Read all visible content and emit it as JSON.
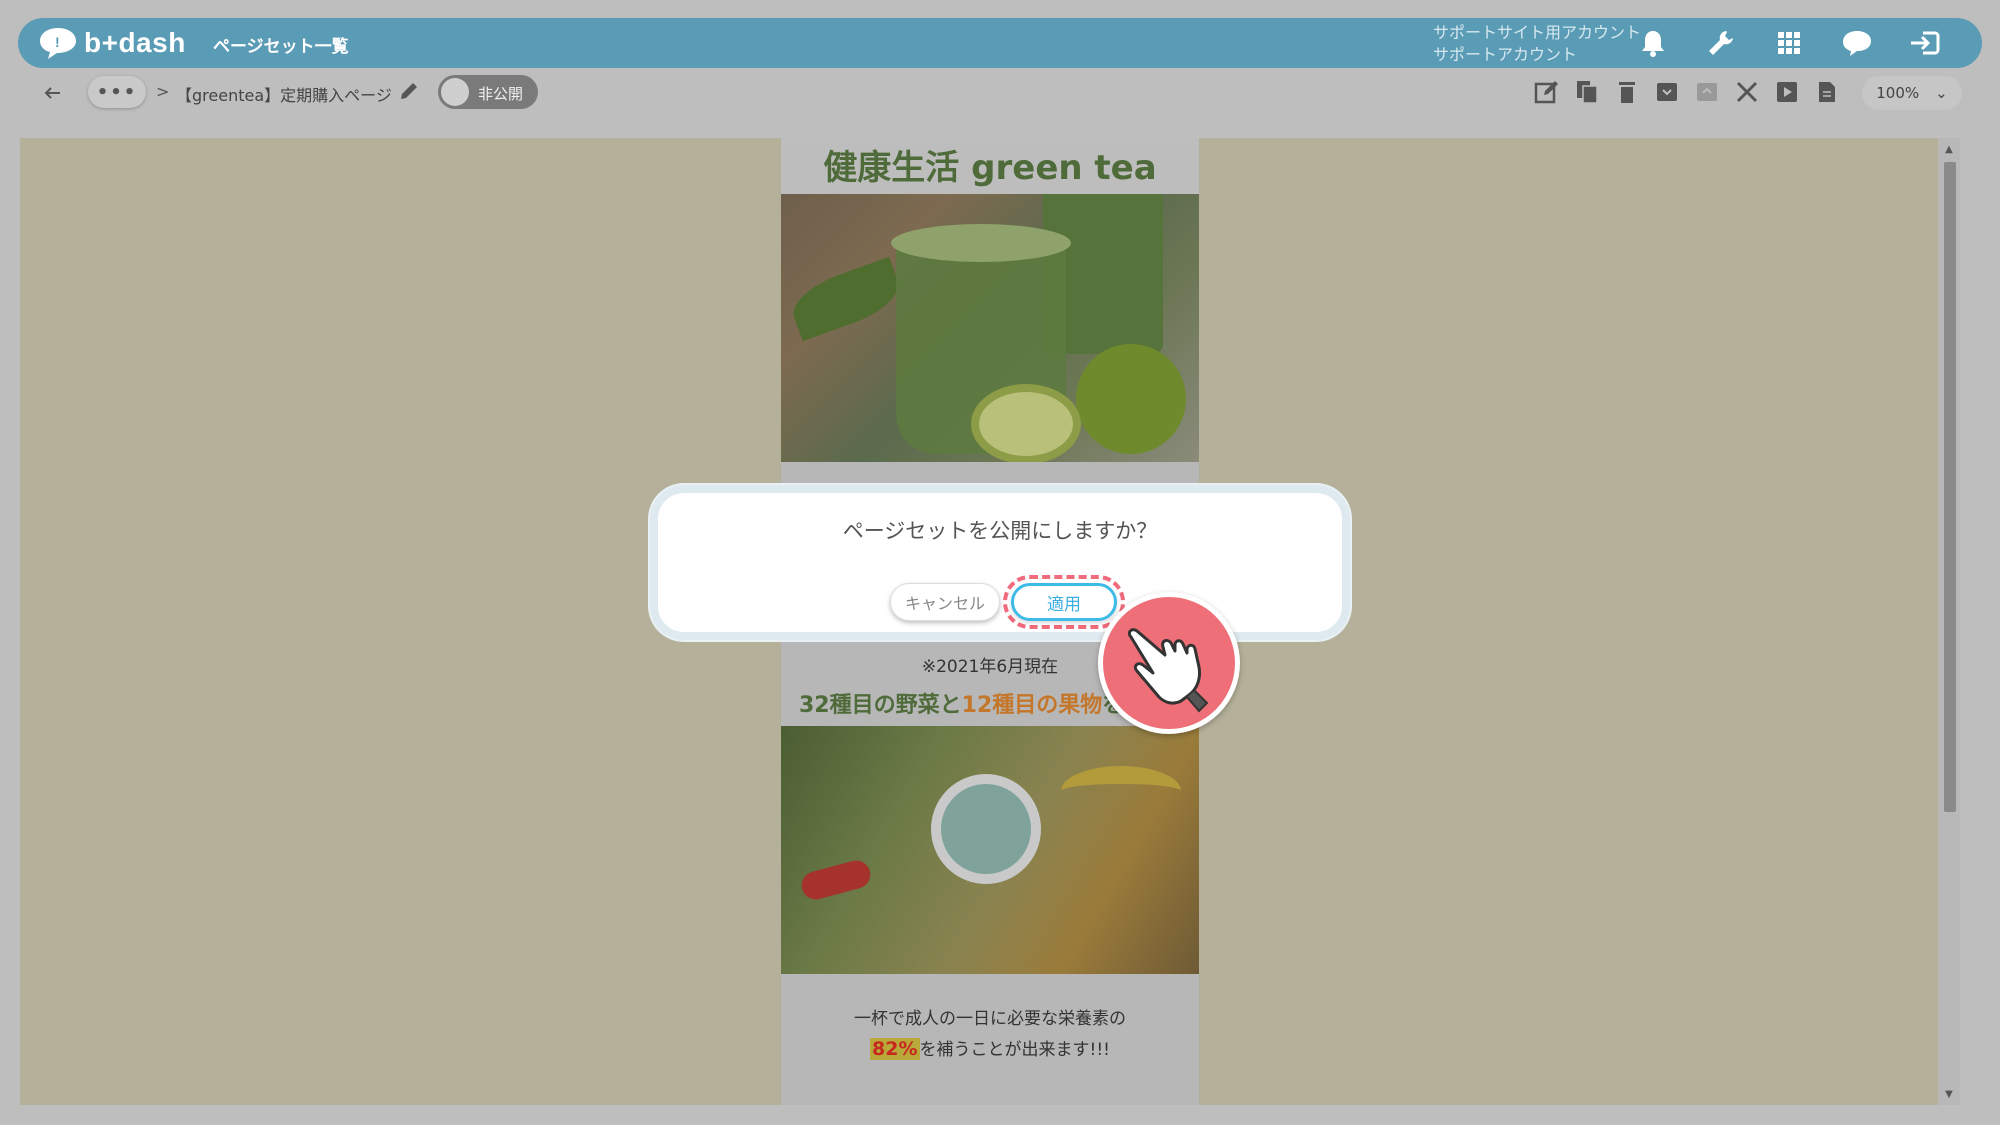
{
  "header": {
    "logo_text": "b+dash",
    "nav_title": "ページセット一覧",
    "account_line1": "サポートサイト用アカウント",
    "account_line2": "サポートアカウント",
    "icons": [
      "bell-icon",
      "wrench-icon",
      "grid-icon",
      "chat-icon",
      "logout-icon"
    ],
    "brand_color": "#5a9bb6"
  },
  "toolbar": {
    "more_label": "•••",
    "separator": ">",
    "page_name": "【greentea】定期購入ページ",
    "toggle_label": "非公開",
    "zoom": "100%",
    "zoom_chevron": "⌄",
    "icons": [
      "edit-icon",
      "copy-icon",
      "trash-icon",
      "archive-icon",
      "export-icon",
      "tools-icon",
      "play-icon",
      "document-icon"
    ]
  },
  "preview": {
    "title": "健康生活 green tea",
    "note": "※2021年6月現在",
    "veg_title_part1": "32種目の野菜",
    "veg_title_and": "と",
    "veg_title_part2": "12種目の果物",
    "veg_title_part3": "を",
    "text_line1": "一杯で成人の一日に必要な栄養素の",
    "text_pct": "82%",
    "text_line2_rest": "を補うことが出来ます!!!"
  },
  "dialog": {
    "message": "ページセットを公開にしますか？",
    "cancel_label": "キャンセル",
    "apply_label": "適用",
    "highlight_color": "#ef6b7b",
    "apply_color": "#3dbbe6"
  }
}
